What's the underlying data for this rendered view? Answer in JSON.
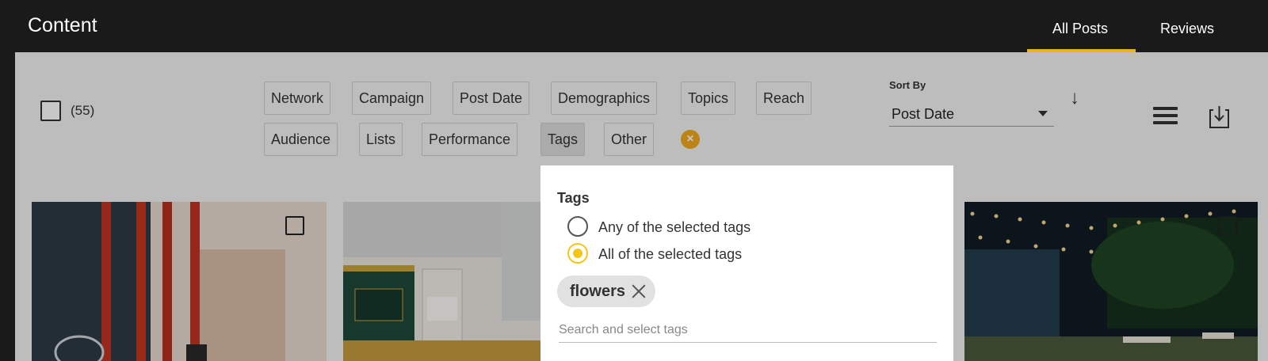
{
  "header": {
    "title": "Content",
    "tabs": [
      {
        "label": "All Posts",
        "active": true
      },
      {
        "label": "Reviews",
        "active": false
      }
    ]
  },
  "toolbar": {
    "count": "(55)",
    "filters_row1": [
      "Network",
      "Campaign",
      "Post Date",
      "Demographics",
      "Topics",
      "Reach"
    ],
    "filters_row2": [
      "Audience",
      "Lists",
      "Performance",
      "Tags",
      "Other"
    ],
    "active_filter": "Tags",
    "clear_icon": "close-circle-icon",
    "sort_label": "Sort By",
    "sort_value": "Post Date",
    "sort_direction_icon": "arrow-down-icon",
    "view_icon": "list-view-icon",
    "export_icon": "download-icon"
  },
  "tags_dropdown": {
    "title": "Tags",
    "options": [
      {
        "label": "Any of the selected tags",
        "selected": false
      },
      {
        "label": "All of the selected tags",
        "selected": true
      }
    ],
    "selected_tags": [
      "flowers"
    ],
    "search_placeholder": "Search and select tags"
  },
  "colors": {
    "accent": "#e8b31b",
    "clear_button": "#f4a81d",
    "radio_selected": "#f5c518",
    "topbar": "#1a1a1a"
  }
}
